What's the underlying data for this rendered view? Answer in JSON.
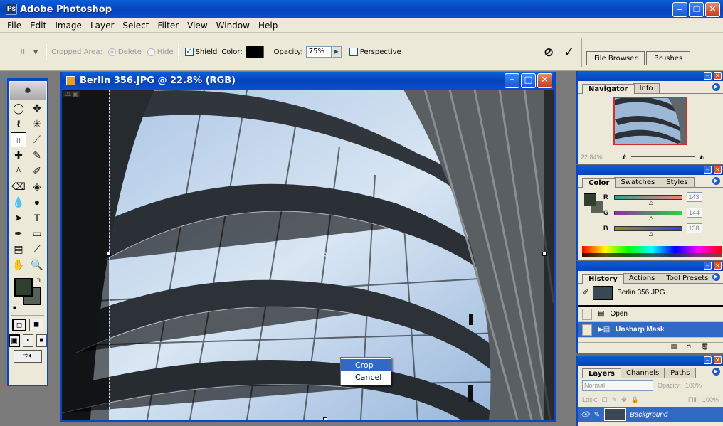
{
  "app": {
    "title": "Adobe Photoshop"
  },
  "menu": [
    "File",
    "Edit",
    "Image",
    "Layer",
    "Select",
    "Filter",
    "View",
    "Window",
    "Help"
  ],
  "options": {
    "cropped_area_label": "Cropped Area:",
    "delete_label": "Delete",
    "hide_label": "Hide",
    "shield_label": "Shield",
    "color_label": "Color:",
    "opacity_label": "Opacity:",
    "opacity_value": "75%",
    "perspective_label": "Perspective",
    "shield_checked": true,
    "perspective_checked": false,
    "shield_color": "#000000"
  },
  "palette_well": {
    "tabs": [
      "File Browser",
      "Brushes"
    ]
  },
  "document": {
    "title": "Berlin 356.JPG @ 22.8% (RGB)"
  },
  "context_menu": {
    "items": [
      "Crop",
      "Cancel"
    ],
    "highlighted": 0
  },
  "navigator": {
    "tabs": [
      "Navigator",
      "Info"
    ],
    "zoom": "22.84%"
  },
  "color": {
    "tabs": [
      "Color",
      "Swatches",
      "Styles"
    ],
    "channels": [
      {
        "label": "R",
        "value": "143"
      },
      {
        "label": "G",
        "value": "144"
      },
      {
        "label": "B",
        "value": "138"
      }
    ],
    "foreground": "#2f3f2d",
    "background": "#596156"
  },
  "history": {
    "tabs": [
      "History",
      "Actions",
      "Tool Presets"
    ],
    "snapshot": "Berlin 356.JPG",
    "steps": [
      "Open",
      "Unsharp Mask"
    ],
    "selected": 1
  },
  "layers": {
    "tabs": [
      "Layers",
      "Channels",
      "Paths"
    ],
    "blend_mode": "Normal",
    "opacity_label": "Opacity:",
    "opacity_value": "100%",
    "lock_label": "Lock:",
    "fill_label": "Fill:",
    "fill_value": "100%",
    "layer_name": "Background"
  }
}
